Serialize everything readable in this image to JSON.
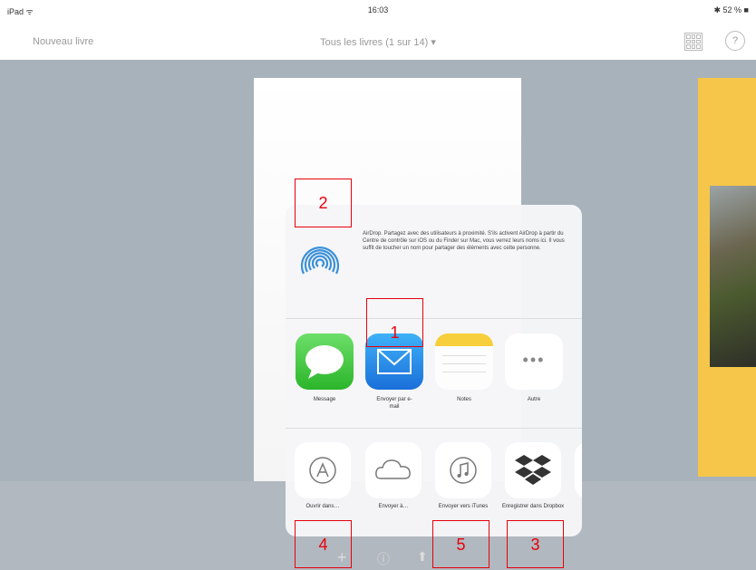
{
  "statusbar": {
    "device": "iPad ᯤ",
    "time": "16:03",
    "battery": "✱ 52 % ■"
  },
  "navbar": {
    "left": "Nouveau livre",
    "title": "Tous les livres (1 sur 14) ▾",
    "help": "?"
  },
  "share_sheet": {
    "airdrop_text": "AirDrop. Partagez avec des utilisateurs à proximité. S'ils activent AirDrop à partir du Centre de contrôle sur iOS ou du Finder sur Mac, vous verrez leurs noms ici. Il vous suffit de toucher un nom pour partager des éléments avec cette personne.",
    "apps": [
      {
        "label": "Message"
      },
      {
        "label": "Envoyer par e-mail"
      },
      {
        "label": "Notes"
      },
      {
        "label": "Autre"
      }
    ],
    "actions": [
      {
        "label": "Ouvrir dans…"
      },
      {
        "label": "Envoyer à…"
      },
      {
        "label": "Envoyer vers iTunes"
      },
      {
        "label": "Enregistrer dans Dropbox"
      }
    ]
  },
  "annotations": [
    "1",
    "2",
    "3",
    "4",
    "5"
  ],
  "colors": {
    "accent": "#e8000b",
    "book_right": "#f5c64a",
    "background": "#a8b2bb"
  }
}
